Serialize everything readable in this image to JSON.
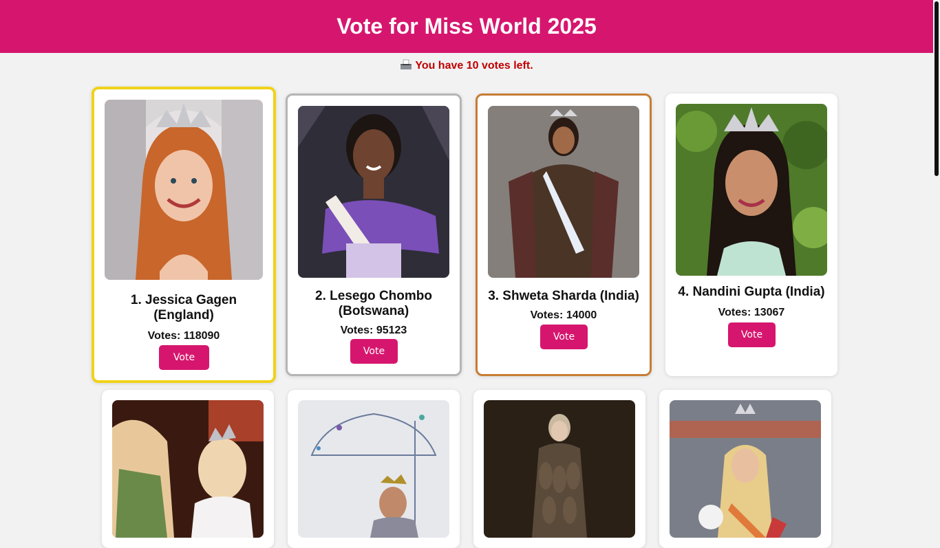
{
  "header": {
    "title": "Vote for Miss World 2025"
  },
  "status": {
    "ballot_icon": "ballot-box-icon",
    "votes_left_text": "You have 10 votes left."
  },
  "colors": {
    "accent": "#d6166e",
    "gold": "#f0d21a",
    "silver": "#b5b5b5",
    "bronze": "#c67d34",
    "warning": "#c00000"
  },
  "contestants": [
    {
      "name": "1. Jessica Gagen (England)",
      "votes": "Votes: 118090",
      "button": "Vote",
      "rank_style": "gold"
    },
    {
      "name": "2. Lesego Chombo (Botswana)",
      "votes": "Votes: 95123",
      "button": "Vote",
      "rank_style": "silver"
    },
    {
      "name": "3. Shweta Sharda (India)",
      "votes": "Votes: 14000",
      "button": "Vote",
      "rank_style": "bronze"
    },
    {
      "name": "4. Nandini Gupta (India)",
      "votes": "Votes: 13067",
      "button": "Vote",
      "rank_style": "none"
    },
    {
      "name": "",
      "votes": "",
      "button": "",
      "rank_style": "none"
    },
    {
      "name": "",
      "votes": "",
      "button": "",
      "rank_style": "none"
    },
    {
      "name": "",
      "votes": "",
      "button": "",
      "rank_style": "none"
    },
    {
      "name": "",
      "votes": "",
      "button": "",
      "rank_style": "none"
    }
  ]
}
